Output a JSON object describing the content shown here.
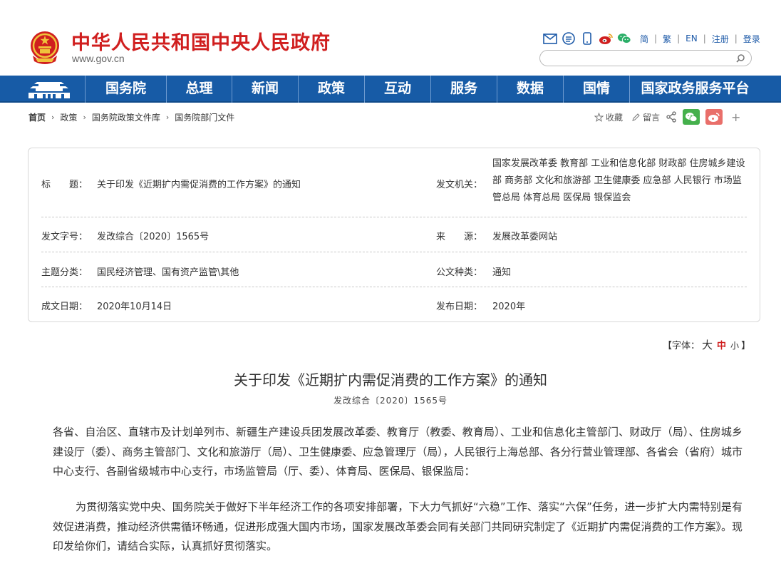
{
  "header": {
    "site_title": "中华人民共和国中央人民政府",
    "site_url": "www.gov.cn",
    "tools": [
      {
        "name": "mail-icon"
      },
      {
        "name": "rss-icon"
      },
      {
        "name": "mobile-icon"
      },
      {
        "name": "weibo-icon"
      },
      {
        "name": "wechat-icon"
      }
    ],
    "lang_simplified": "简",
    "lang_traditional": "繁",
    "lang_en": "EN",
    "register": "注册",
    "login": "登录",
    "search_placeholder": ""
  },
  "nav": {
    "items": [
      "国务院",
      "总理",
      "新闻",
      "政策",
      "互动",
      "服务",
      "数据",
      "国情",
      "国家政务服务平台"
    ]
  },
  "breadcrumb": {
    "home": "首页",
    "items": [
      "政策",
      "国务院政策文件库",
      "国务院部门文件"
    ],
    "separator": "›"
  },
  "crumb_tools": {
    "favorite": "收藏",
    "comment": "留言",
    "plus": "+"
  },
  "info": {
    "title_label": "标　　题：",
    "title_value": "关于印发《近期扩内需促消费的工作方案》的通知",
    "issuer_label": "发文机关：",
    "issuer_value": "国家发展改革委  教育部  工业和信息化部  财政部  住房城乡建设部  商务部  文化和旅游部  卫生健康委  应急部  人民银行  市场监管总局  体育总局  医保局  银保监会",
    "docno_label": "发文字号：",
    "docno_value": "发改综合〔2020〕1565号",
    "source_label": "来　　源：",
    "source_value": "发展改革委网站",
    "topic_label": "主题分类：",
    "topic_value": "国民经济管理、国有资产监管\\其他",
    "type_label": "公文种类：",
    "type_value": "通知",
    "date_label": "成文日期：",
    "date_value": "2020年10月14日",
    "pub_label": "发布日期：",
    "pub_value": "2020年"
  },
  "fontsize": {
    "open": "【字体：",
    "large": "大",
    "medium": "中",
    "small": "小",
    "close": "】"
  },
  "article": {
    "title": "关于印发《近期扩内需促消费的工作方案》的通知",
    "doc_number": "发改综合〔2020〕1565号",
    "para1": "各省、自治区、直辖市及计划单列市、新疆生产建设兵团发展改革委、教育厅（教委、教育局）、工业和信息化主管部门、财政厅（局）、住房城乡建设厅（委）、商务主管部门、文化和旅游厅（局）、卫生健康委、应急管理厅（局），人民银行上海总部、各分行营业管理部、各省会（省府）城市中心支行、各副省级城市中心支行，市场监管局（厅、委）、体育局、医保局、银保监局：",
    "para2": "为贯彻落实党中央、国务院关于做好下半年经济工作的各项安排部署，下大力气抓好“六稳”工作、落实“六保”任务，进一步扩大内需特别是有效促进消费，推动经济供需循环畅通，促进形成强大国内市场，国家发展改革委会同有关部门共同研究制定了《近期扩内需促消费的工作方案》。现印发给你们，请结合实际，认真抓好贯彻落实。"
  },
  "colors": {
    "brand_red": "#d01f1f",
    "nav_blue": "#175ba6",
    "link_blue": "#1d5aa8"
  }
}
